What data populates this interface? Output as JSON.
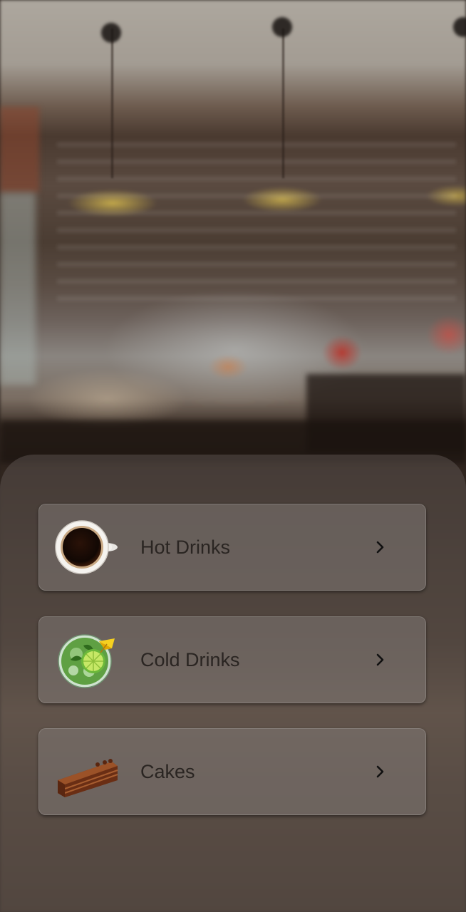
{
  "menu": {
    "items": [
      {
        "label": "Hot Drinks",
        "icon": "coffee-cup-icon"
      },
      {
        "label": "Cold Drinks",
        "icon": "mojito-glass-icon"
      },
      {
        "label": "Cakes",
        "icon": "cake-slice-icon"
      }
    ],
    "chevron_icon": "chevron-right-icon"
  },
  "colors": {
    "sheet": "#5a504c",
    "card": "#807874",
    "text": "#2a2522"
  }
}
